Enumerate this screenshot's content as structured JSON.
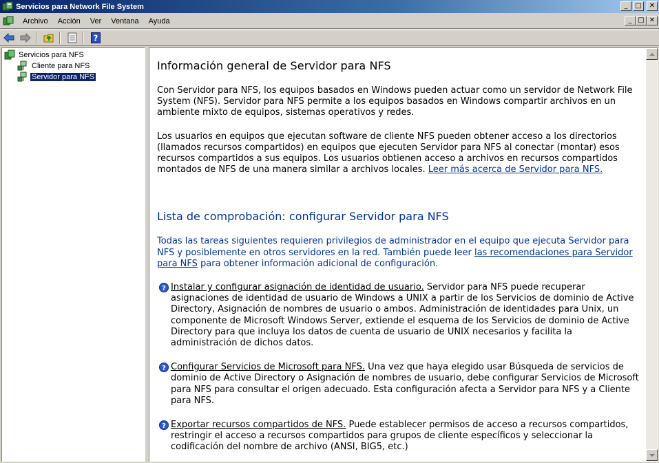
{
  "window": {
    "title": "Servicios para Network File System"
  },
  "menu": [
    "Archivo",
    "Acción",
    "Ver",
    "Ventana",
    "Ayuda"
  ],
  "window_buttons": {
    "minimize": "_",
    "maximize": "□",
    "close": "✕"
  },
  "tree": {
    "root": "Servicios para NFS",
    "children": [
      "Cliente para NFS",
      "Servidor para NFS"
    ]
  },
  "content": {
    "overview_title": "Información general de Servidor para NFS",
    "overview_p1": "Con Servidor para NFS, los equipos basados en Windows pueden actuar como un servidor de Network File System (NFS). Servidor para NFS permite a los equipos basados en Windows compartir archivos en un ambiente mixto de equipos, sistemas operativos y redes.",
    "overview_p2": "Los usuarios en equipos que ejecutan software de cliente NFS pueden obtener acceso a los directorios (llamados recursos compartidos) en equipos que ejecuten Servidor para NFS al conectar (montar) esos recursos compartidos a sus equipos.  Los usuarios obtienen acceso a archivos en recursos compartidos montados de NFS de una manera similar a archivos locales.",
    "overview_link": "Leer más acerca de Servidor para NFS.",
    "checklist_title": "Lista de comprobación: configurar Servidor para NFS",
    "checklist_p1": "Todas las tareas siguientes requieren privilegios de administrador en el equipo que ejecuta Servidor para NFS y posiblemente en otros servidores en la red.  También puede leer",
    "checklist_link": "las recomendaciones para Servidor para NFS",
    "checklist_p1_end": "para obtener información adicional de configuración.",
    "tasks": [
      {
        "link": "Instalar y configurar asignación de identidad de usuario.",
        "text": "Servidor para NFS puede recuperar asignaciones de identidad de usuario de Windows a UNIX a partir de los Servicios de dominio de Active Directory, Asignación de nombres de usuario o ambos. Administración de identidades para Unix, un componente de Microsoft Windows Server, extiende el esquema de los Servicios de dominio de Active Directory para que incluya los datos de cuenta de usuario de UNIX necesarios y facilita la administración de dichos datos."
      },
      {
        "link": "Configurar Servicios de Microsoft para NFS.",
        "text": "Una vez que haya elegido usar Búsqueda de servicios de dominio de Active Directory o Asignación de nombres de usuario, debe configurar Servicios de Microsoft para NFS para consultar el origen adecuado.  Esta configuración afecta a Servidor para NFS y a Cliente para NFS."
      },
      {
        "link": "Exportar recursos compartidos de NFS.",
        "text": "Puede establecer permisos de acceso a recursos compartidos, restringir el acceso a recursos compartidos para grupos de cliente específicos y seleccionar la codificación del nombre de archivo (ANSI, BIG5, etc.)"
      }
    ]
  },
  "colors": {
    "title_bar": "#0a246a",
    "link_blue": "#003399",
    "selection": "#0a246a",
    "chrome": "#d4d0c8"
  },
  "icons": [
    "nfs-services-icon",
    "back-arrow-icon",
    "forward-arrow-icon",
    "up-folder-icon",
    "properties-icon",
    "help-icon",
    "help-question-icon"
  ]
}
